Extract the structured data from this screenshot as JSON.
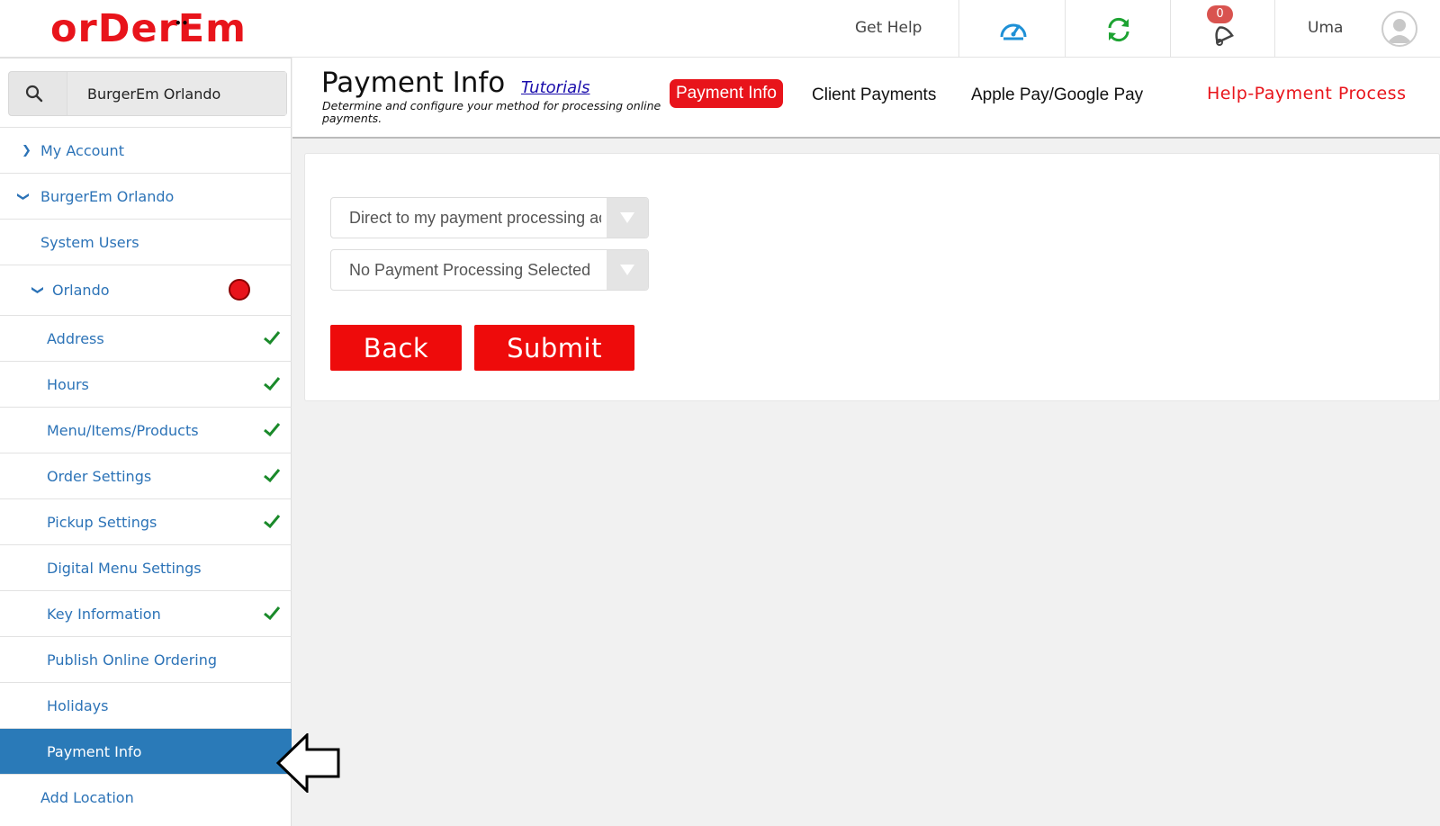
{
  "header": {
    "logo_text": "orDerEm",
    "get_help": "Get Help",
    "notification_count": "0",
    "user_name": "Uma",
    "icons": [
      "dashboard-gauge-icon",
      "refresh-icon",
      "bell-icon",
      "user-avatar-icon"
    ]
  },
  "sidebar": {
    "search_value": "BurgerEm Orlando",
    "items": [
      {
        "label": "My Account",
        "icon": "chevron-right-icon"
      },
      {
        "label": "BurgerEm Orlando",
        "icon": "chevron-down-icon"
      },
      {
        "label": "System Users"
      },
      {
        "label": "Orlando",
        "icon": "chevron-down-icon",
        "status": "red-dot"
      },
      {
        "label": "Address",
        "checked": true
      },
      {
        "label": "Hours",
        "checked": true
      },
      {
        "label": "Menu/Items/Products",
        "checked": true
      },
      {
        "label": "Order Settings",
        "checked": true
      },
      {
        "label": "Pickup Settings",
        "checked": true
      },
      {
        "label": "Digital Menu Settings",
        "checked": false
      },
      {
        "label": "Key Information",
        "checked": true
      },
      {
        "label": "Publish Online Ordering",
        "checked": false
      },
      {
        "label": "Holidays",
        "checked": false
      },
      {
        "label": "Payment Info",
        "active": true
      },
      {
        "label": "Add Location"
      }
    ]
  },
  "page": {
    "title": "Payment Info",
    "tutorials": "Tutorials",
    "subtitle": "Determine and configure your method for processing online payments.",
    "tabs": [
      {
        "label": "Payment Info",
        "active": true
      },
      {
        "label": "Client Payments"
      },
      {
        "label": "Apple Pay/Google Pay"
      }
    ],
    "help_link": "Help-Payment Process"
  },
  "form": {
    "method_select": "Direct to my payment processing account",
    "processor_select": "No Payment Processing Selected",
    "back_label": "Back",
    "submit_label": "Submit"
  },
  "colors": {
    "brand_red": "#e8141b",
    "link_blue": "#2c73b7",
    "active_blue": "#2a7ab8",
    "check_green": "#1a8a2a"
  }
}
